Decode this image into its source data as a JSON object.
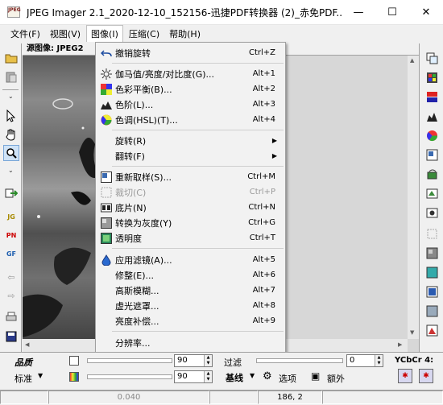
{
  "window": {
    "title": "JPEG Imager 2.1_2020-12-10_152156-迅捷PDF转换器 (2)_赤免PDF...",
    "app_icon_text": "JPEG",
    "minimize": "—",
    "maximize": "☐",
    "close": "✕"
  },
  "menubar": {
    "items": [
      {
        "label": "文件(F)"
      },
      {
        "label": "视图(V)"
      },
      {
        "label": "图像(I)"
      },
      {
        "label": "压缩(C)"
      },
      {
        "label": "帮助(H)"
      }
    ]
  },
  "canvas": {
    "header": "源图像: JPEG2"
  },
  "image_menu": {
    "items": [
      {
        "label": "撤销旋转",
        "shortcut": "Ctrl+Z",
        "icon": "undo-icon"
      },
      {
        "label": "伽马值/亮度/对比度(G)...",
        "shortcut": "Alt+1",
        "icon": "brightness-icon"
      },
      {
        "label": "色彩平衡(B)...",
        "shortcut": "Alt+2",
        "icon": "color-balance-icon"
      },
      {
        "label": "色阶(L)...",
        "shortcut": "Alt+3",
        "icon": "levels-icon"
      },
      {
        "label": "色调(HSL)(T)...",
        "shortcut": "Alt+4",
        "icon": "hue-icon"
      },
      {
        "label": "旋转(R)",
        "icon": ""
      },
      {
        "label": "翻转(F)",
        "icon": ""
      },
      {
        "label": "重新取样(S)...",
        "shortcut": "Ctrl+M",
        "icon": "resample-icon"
      },
      {
        "label": "裁切(C)",
        "shortcut": "Ctrl+P",
        "icon": "crop-icon"
      },
      {
        "label": "底片(N)",
        "shortcut": "Ctrl+N",
        "icon": "negative-icon"
      },
      {
        "label": "转换为灰度(Y)",
        "shortcut": "Ctrl+G",
        "icon": "grayscale-icon"
      },
      {
        "label": "透明度",
        "shortcut": "Ctrl+T",
        "icon": "transparency-icon"
      },
      {
        "label": "应用滤镜(A)...",
        "shortcut": "Alt+5",
        "icon": "filter-icon"
      },
      {
        "label": "修整(E)...",
        "shortcut": "Alt+6",
        "icon": ""
      },
      {
        "label": "高斯模糊...",
        "shortcut": "Alt+7",
        "icon": ""
      },
      {
        "label": "虚光遮罩...",
        "shortcut": "Alt+8",
        "icon": ""
      },
      {
        "label": "亮度补偿...",
        "shortcut": "Alt+9",
        "icon": ""
      },
      {
        "label": "分辨率...",
        "icon": ""
      }
    ]
  },
  "bottom": {
    "quality_label": "品质",
    "standard_label": "标准",
    "quality_value": "90",
    "standard_value": "90",
    "filter_label": "过滤",
    "filter_value": "0",
    "baseline_label": "基线",
    "options_label": "选项",
    "extra_label": "额外",
    "ycbcr_label": "YCbCr 4:"
  },
  "status": {
    "size_value": "0.040",
    "coords": "186, 2"
  }
}
